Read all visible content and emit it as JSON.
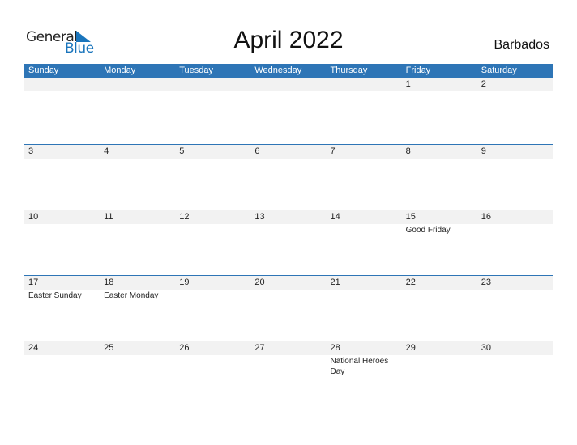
{
  "logo": {
    "line1": "General",
    "line2": "Blue"
  },
  "title": "April 2022",
  "country": "Barbados",
  "colors": {
    "header": "#2e75b6",
    "strip": "#f2f2f2",
    "logo_blue": "#1a75bc"
  },
  "weekdays": [
    "Sunday",
    "Monday",
    "Tuesday",
    "Wednesday",
    "Thursday",
    "Friday",
    "Saturday"
  ],
  "weeks": [
    [
      {
        "d": ""
      },
      {
        "d": ""
      },
      {
        "d": ""
      },
      {
        "d": ""
      },
      {
        "d": ""
      },
      {
        "d": "1"
      },
      {
        "d": "2"
      }
    ],
    [
      {
        "d": "3"
      },
      {
        "d": "4"
      },
      {
        "d": "5"
      },
      {
        "d": "6"
      },
      {
        "d": "7"
      },
      {
        "d": "8"
      },
      {
        "d": "9"
      }
    ],
    [
      {
        "d": "10"
      },
      {
        "d": "11"
      },
      {
        "d": "12"
      },
      {
        "d": "13"
      },
      {
        "d": "14"
      },
      {
        "d": "15",
        "h": "Good Friday"
      },
      {
        "d": "16"
      }
    ],
    [
      {
        "d": "17",
        "h": "Easter Sunday"
      },
      {
        "d": "18",
        "h": "Easter Monday"
      },
      {
        "d": "19"
      },
      {
        "d": "20"
      },
      {
        "d": "21"
      },
      {
        "d": "22"
      },
      {
        "d": "23"
      }
    ],
    [
      {
        "d": "24"
      },
      {
        "d": "25"
      },
      {
        "d": "26"
      },
      {
        "d": "27"
      },
      {
        "d": "28",
        "h": "National Heroes Day"
      },
      {
        "d": "29"
      },
      {
        "d": "30"
      }
    ]
  ]
}
